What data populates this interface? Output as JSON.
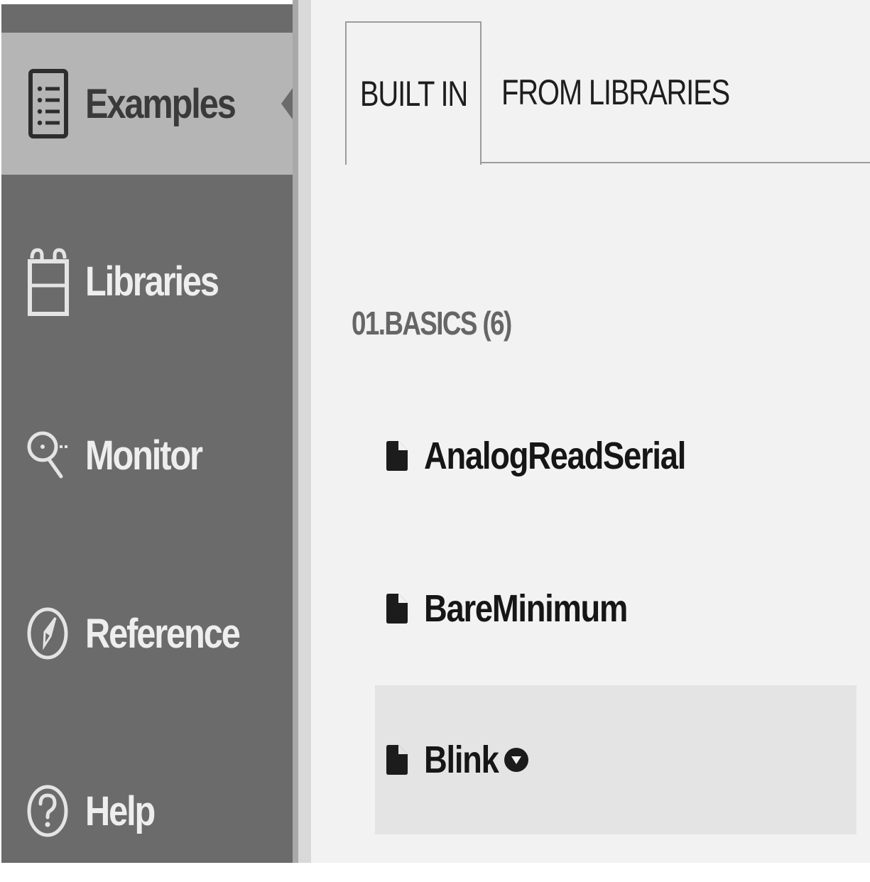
{
  "sidebar": {
    "items": [
      {
        "label": "Examples",
        "icon": "examples-list-icon",
        "active": true
      },
      {
        "label": "Libraries",
        "icon": "libraries-icon",
        "active": false
      },
      {
        "label": "Monitor",
        "icon": "monitor-magnifier-icon",
        "active": false
      },
      {
        "label": "Reference",
        "icon": "compass-icon",
        "active": false
      },
      {
        "label": "Help",
        "icon": "help-question-icon",
        "active": false
      }
    ]
  },
  "tabs": [
    {
      "label": "BUILT IN",
      "selected": true
    },
    {
      "label": "FROM LIBRARIES",
      "selected": false
    }
  ],
  "section": {
    "title": "01.BASICS (6)"
  },
  "examples": [
    {
      "label": "AnalogReadSerial",
      "icon": "file-icon",
      "highlighted": false
    },
    {
      "label": "BareMinimum",
      "icon": "file-icon",
      "highlighted": false
    },
    {
      "label": "Blink",
      "icon": "file-icon",
      "highlighted": true,
      "menu_icon": "chevron-down-circle-icon"
    }
  ],
  "colors": {
    "sidebar_bg": "#6b6b6b",
    "sidebar_active_bg": "#b5b5b5",
    "main_bg": "#f2f2f2",
    "row_highlight": "#e4e4e4"
  }
}
